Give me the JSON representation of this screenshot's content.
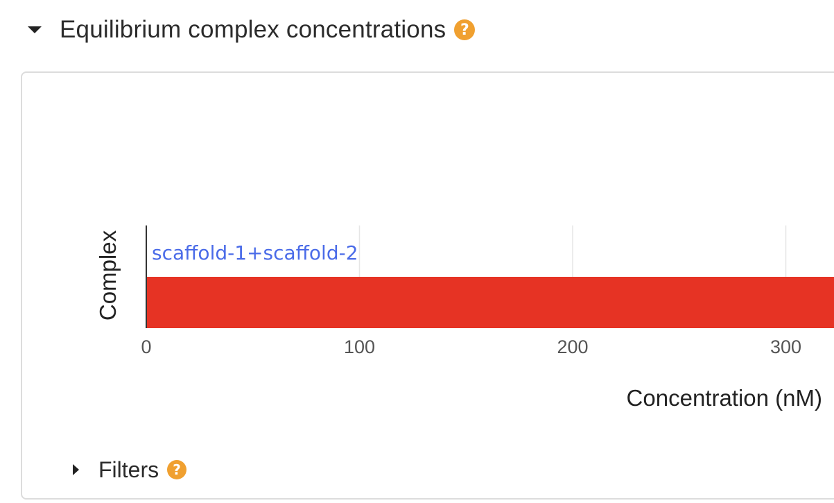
{
  "section": {
    "title": "Equilibrium complex concentrations",
    "help_glyph": "?"
  },
  "filters": {
    "label": "Filters",
    "help_glyph": "?"
  },
  "colors": {
    "bar": "#e63324",
    "bar_label": "#4a6be8",
    "help": "#f0a030",
    "grid": "#e6e6e6"
  },
  "chart_data": {
    "type": "bar",
    "orientation": "horizontal",
    "categories": [
      "scaffold-1+scaffold-2"
    ],
    "values": [
      330
    ],
    "xlabel": "Concentration (nM)",
    "ylabel": "Complex",
    "xticks": [
      "0",
      "100",
      "200",
      "300"
    ],
    "xtick_values": [
      0,
      100,
      200,
      300
    ],
    "grid": true
  }
}
